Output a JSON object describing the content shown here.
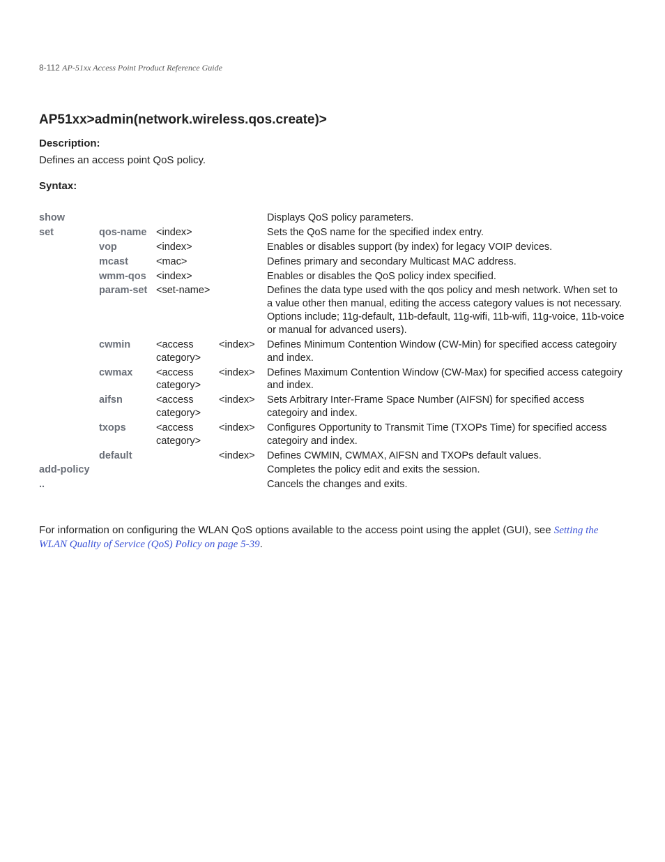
{
  "header": {
    "page_num": "8-112",
    "doc_title": "AP-51xx Access Point Product Reference Guide"
  },
  "title": "AP51xx>admin(network.wireless.qos.create)>",
  "description_heading": "Description:",
  "description_body": "Defines an access point QoS policy.",
  "syntax_heading": "Syntax:",
  "rows": [
    {
      "c1": "show",
      "c2": "",
      "c3": "",
      "c4": "",
      "c5": "Displays QoS policy parameters."
    },
    {
      "c1": "set",
      "c2": "qos-name",
      "c3": "<index>",
      "c4": "",
      "c5": "Sets the QoS name for the specified index entry."
    },
    {
      "c1": "",
      "c2": "vop",
      "c3": "<index>",
      "c4": "",
      "c5": "Enables or disables support (by index) for legacy VOIP devices."
    },
    {
      "c1": "",
      "c2": "mcast",
      "c3": "<mac>",
      "c4": "",
      "c5": "Defines primary and secondary Multicast MAC address."
    },
    {
      "c1": "",
      "c2": "wmm-qos",
      "c3": "<index>",
      "c4": "",
      "c5": "Enables or disables the QoS policy index specified."
    },
    {
      "c1": "",
      "c2": "param-set",
      "c3": "<set-name>",
      "c4": "",
      "c5": "Defines the data type used with the qos policy and mesh network. When set to a value other then manual, editing the access category values is not necessary. Options include; 11g-default, 11b-default, 11g-wifi, 11b-wifi, 11g-voice, 11b-voice or manual for advanced users)."
    },
    {
      "c1": "",
      "c2": "cwmin",
      "c3": "<access category>",
      "c4": "<index>",
      "c5": "Defines Minimum Contention Window (CW-Min) for specified access categoiry and index."
    },
    {
      "c1": "",
      "c2": "cwmax",
      "c3": "<access category>",
      "c4": "<index>",
      "c5": "Defines Maximum Contention Window (CW-Max) for specified access categoiry and index."
    },
    {
      "c1": "",
      "c2": "aifsn",
      "c3": "<access category>",
      "c4": "<index>",
      "c5": "Sets Arbitrary Inter-Frame Space Number (AIFSN) for specified access categoiry and index."
    },
    {
      "c1": "",
      "c2": "txops",
      "c3": "<access category>",
      "c4": "<index>",
      "c5": "Configures Opportunity to Transmit Time (TXOPs Time) for specified access categoiry and index."
    },
    {
      "c1": "",
      "c2": "default",
      "c3": "",
      "c4": "<index>",
      "c5": "Defines CWMIN, CWMAX, AIFSN and TXOPs default values."
    },
    {
      "c1": "add-policy",
      "c2": "",
      "c3": "",
      "c4": "",
      "c5": "Completes the policy edit and exits the session."
    },
    {
      "c1": "..",
      "c2": "",
      "c3": "",
      "c4": "",
      "c5": "Cancels the changes and exits."
    }
  ],
  "footnote": {
    "prefix": "For information on configuring the WLAN QoS options available to the access point using the applet (GUI), see ",
    "link": "Setting the WLAN Quality of Service (QoS) Policy on page 5-39",
    "suffix": "."
  }
}
